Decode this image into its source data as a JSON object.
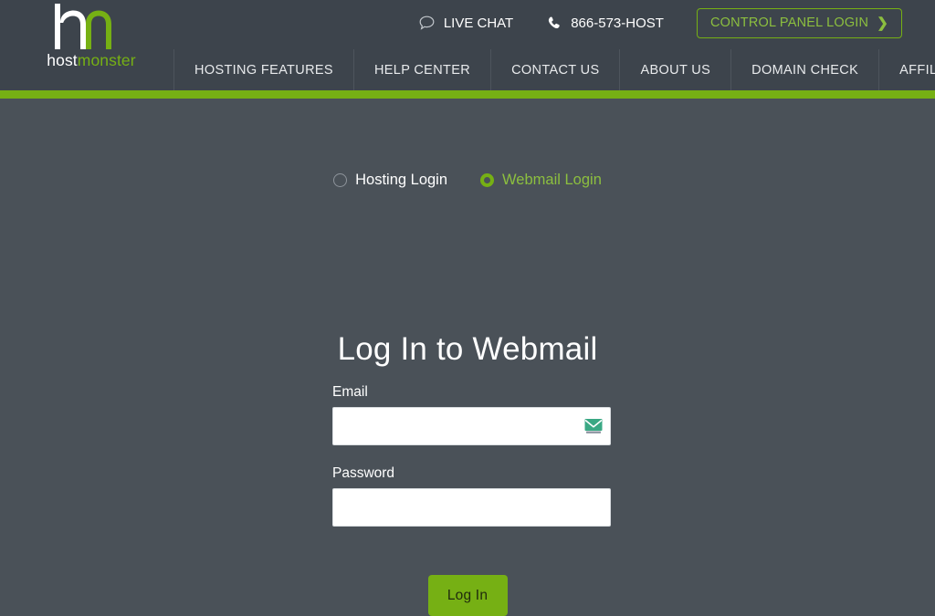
{
  "header": {
    "logo": {
      "name": "hostmonster",
      "word_first": "host",
      "word_second": "monster",
      "mark_icon": "hm-monogram-icon",
      "colors": {
        "white": "#ffffff",
        "green": "#76b014"
      }
    },
    "utility": [
      {
        "icon": "chat-bubble-icon",
        "label": "LIVE CHAT"
      },
      {
        "icon": "phone-icon",
        "label": "866-573-HOST"
      }
    ],
    "control_panel_button": {
      "label": "CONTROL PANEL LOGIN",
      "chevron": "❯",
      "border_color": "#76b014",
      "text_color": "#8cbf3f"
    },
    "nav": [
      {
        "label": "HOSTING FEATURES"
      },
      {
        "label": "HELP CENTER"
      },
      {
        "label": "CONTACT US"
      },
      {
        "label": "ABOUT US"
      },
      {
        "label": "DOMAIN CHECK"
      },
      {
        "label": "AFFILIATES"
      }
    ],
    "accent_bar_color": "#76b014",
    "background_color": "#3d444c"
  },
  "main": {
    "background_color": "#4a5158",
    "login_type": {
      "options": [
        {
          "label": "Hosting Login",
          "selected": false
        },
        {
          "label": "Webmail Login",
          "selected": true
        }
      ]
    },
    "title": "Log In to Webmail",
    "form": {
      "email": {
        "label": "Email",
        "value": "",
        "placeholder": "",
        "icon": "envelope-autofill-icon"
      },
      "password": {
        "label": "Password",
        "value": "",
        "placeholder": ""
      },
      "submit_label": "Log In",
      "submit_color": "#76b014"
    }
  }
}
